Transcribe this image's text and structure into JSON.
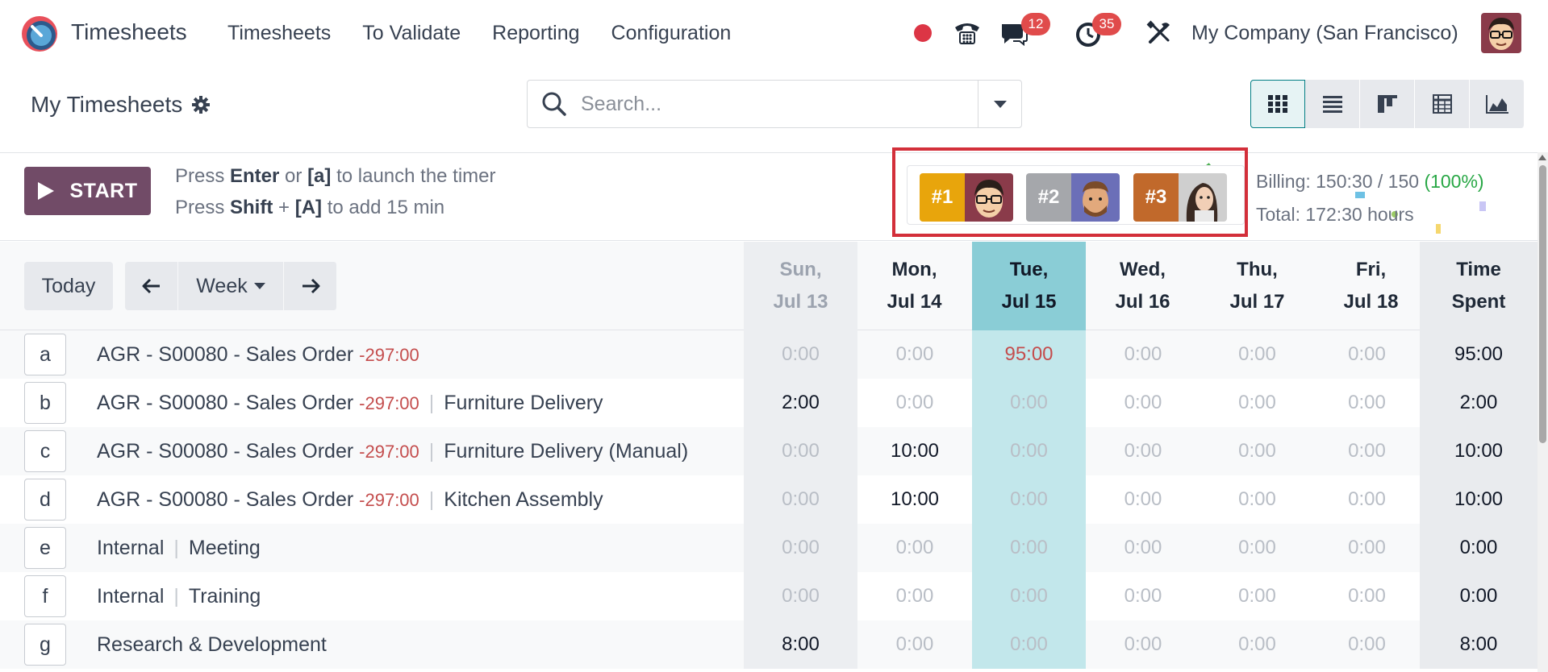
{
  "app": {
    "name": "Timesheets",
    "logo_icon": "timesheets-logo-icon"
  },
  "nav": {
    "items": [
      "Timesheets",
      "To Validate",
      "Reporting",
      "Configuration"
    ]
  },
  "systray": {
    "messages_count": "12",
    "activities_count": "35",
    "company": "My Company (San Francisco)"
  },
  "control": {
    "title": "My Timesheets",
    "search_placeholder": "Search...",
    "views": [
      "grid-icon",
      "list-icon",
      "kanban-icon",
      "pivot-icon",
      "graph-icon"
    ]
  },
  "timer": {
    "start_label": "START",
    "hint1": {
      "a": "Press ",
      "b": "Enter",
      "c": " or ",
      "d": "[a]",
      "e": " to launch the timer"
    },
    "hint2": {
      "a": "Press ",
      "b": "Shift",
      "c": " + ",
      "d": "[A]",
      "e": " to add 15 min"
    }
  },
  "leaderboard": [
    {
      "rank": "#1",
      "color": "#e8a50c"
    },
    {
      "rank": "#2",
      "color": "#a5a7ab"
    },
    {
      "rank": "#3",
      "color": "#c1692b"
    }
  ],
  "summary": {
    "billing_label": "Billing: 150:30 / 150 ",
    "billing_pct": "(100%)",
    "total": "Total: 172:30 hours"
  },
  "grid": {
    "today_label": "Today",
    "period_label": "Week",
    "days": [
      {
        "day": "Sun,",
        "date": "Jul 13"
      },
      {
        "day": "Mon,",
        "date": "Jul 14"
      },
      {
        "day": "Tue,",
        "date": "Jul 15"
      },
      {
        "day": "Wed,",
        "date": "Jul 16"
      },
      {
        "day": "Thu,",
        "date": "Jul 17"
      },
      {
        "day": "Fri,",
        "date": "Jul 18"
      }
    ],
    "total_header": {
      "l1": "Time",
      "l2": "Spent"
    },
    "rows": [
      {
        "key": "a",
        "project": "AGR - S00080 - Sales Order",
        "remaining": "-297:00",
        "task": "",
        "cells": [
          "0:00",
          "0:00",
          "95:00",
          "0:00",
          "0:00",
          "0:00"
        ],
        "total": "95:00"
      },
      {
        "key": "b",
        "project": "AGR - S00080 - Sales Order",
        "remaining": "-297:00",
        "task": "Furniture Delivery",
        "cells": [
          "2:00",
          "0:00",
          "0:00",
          "0:00",
          "0:00",
          "0:00"
        ],
        "total": "2:00"
      },
      {
        "key": "c",
        "project": "AGR - S00080 - Sales Order",
        "remaining": "-297:00",
        "task": "Furniture Delivery (Manual)",
        "cells": [
          "0:00",
          "10:00",
          "0:00",
          "0:00",
          "0:00",
          "0:00"
        ],
        "total": "10:00"
      },
      {
        "key": "d",
        "project": "AGR - S00080 - Sales Order",
        "remaining": "-297:00",
        "task": "Kitchen Assembly",
        "cells": [
          "0:00",
          "10:00",
          "0:00",
          "0:00",
          "0:00",
          "0:00"
        ],
        "total": "10:00"
      },
      {
        "key": "e",
        "project": "Internal",
        "remaining": "",
        "task": "Meeting",
        "cells": [
          "0:00",
          "0:00",
          "0:00",
          "0:00",
          "0:00",
          "0:00"
        ],
        "total": "0:00"
      },
      {
        "key": "f",
        "project": "Internal",
        "remaining": "",
        "task": "Training",
        "cells": [
          "0:00",
          "0:00",
          "0:00",
          "0:00",
          "0:00",
          "0:00"
        ],
        "total": "0:00"
      },
      {
        "key": "g",
        "project": "Research & Development",
        "remaining": "",
        "task": "",
        "cells": [
          "8:00",
          "0:00",
          "0:00",
          "0:00",
          "0:00",
          "0:00"
        ],
        "total": "8:00"
      }
    ]
  },
  "colors": {
    "accent": "#714b67",
    "today_col": "#c2e7eb",
    "today_head": "#8acdd6",
    "negative": "#c44d4d"
  }
}
